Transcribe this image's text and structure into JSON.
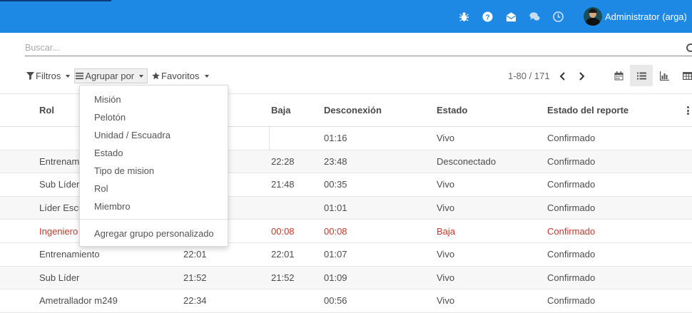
{
  "topbar": {
    "icons": [
      "bug-icon",
      "question-icon",
      "envelope-icon",
      "chat-icon",
      "clock-icon"
    ],
    "user_name": "Administrator (arga)",
    "accent": "#1e88e5"
  },
  "search": {
    "placeholder": "Buscar..."
  },
  "filters": {
    "filtros": "Filtros",
    "agrupar": "Agrupar por",
    "favoritos": "Favoritos"
  },
  "pager": {
    "range": "1-80 / 171"
  },
  "views": [
    "calendar-icon",
    "list-icon",
    "graph-icon",
    "table-icon"
  ],
  "table": {
    "headers": {
      "rol": "Rol",
      "baja": "Baja",
      "desconexion": "Desconexión",
      "estado": "Estado",
      "estado_reporte": "Estado del reporte"
    },
    "rows": [
      {
        "rol": "",
        "hora": "",
        "baja": "",
        "desconexion": "01:16",
        "estado": "Vivo",
        "reporte": "Confirmado"
      },
      {
        "rol": "Entrenam",
        "hora": "",
        "baja": "22:28",
        "desconexion": "23:48",
        "estado": "Desconectado",
        "reporte": "Confirmado"
      },
      {
        "rol": "Sub Líder",
        "hora": "",
        "baja": "21:48",
        "desconexion": "00:35",
        "estado": "Vivo",
        "reporte": "Confirmado"
      },
      {
        "rol": "Líder Escu",
        "hora": "",
        "baja": "",
        "desconexion": "01:01",
        "estado": "Vivo",
        "reporte": "Confirmado"
      },
      {
        "rol": "Ingeniero",
        "hora": "",
        "baja": "00:08",
        "desconexion": "00:08",
        "estado": "Baja",
        "reporte": "Confirmado"
      },
      {
        "rol": "Entrenamiento",
        "hora": "22:01",
        "baja": "22:01",
        "desconexion": "01:07",
        "estado": "Vivo",
        "reporte": "Confirmado"
      },
      {
        "rol": "Sub Líder",
        "hora": "21:52",
        "baja": "21:52",
        "desconexion": "01:09",
        "estado": "Vivo",
        "reporte": "Confirmado"
      },
      {
        "rol": "Ametrallador m249",
        "hora": "22:34",
        "baja": "",
        "desconexion": "00:56",
        "estado": "Vivo",
        "reporte": "Confirmado"
      }
    ]
  },
  "groupby_menu": {
    "items": [
      "Misión",
      "Pelotón",
      "Unidad / Escuadra",
      "Estado",
      "Tipo de mision",
      "Rol",
      "Miembro"
    ],
    "custom": "Agregar grupo personalizado"
  }
}
